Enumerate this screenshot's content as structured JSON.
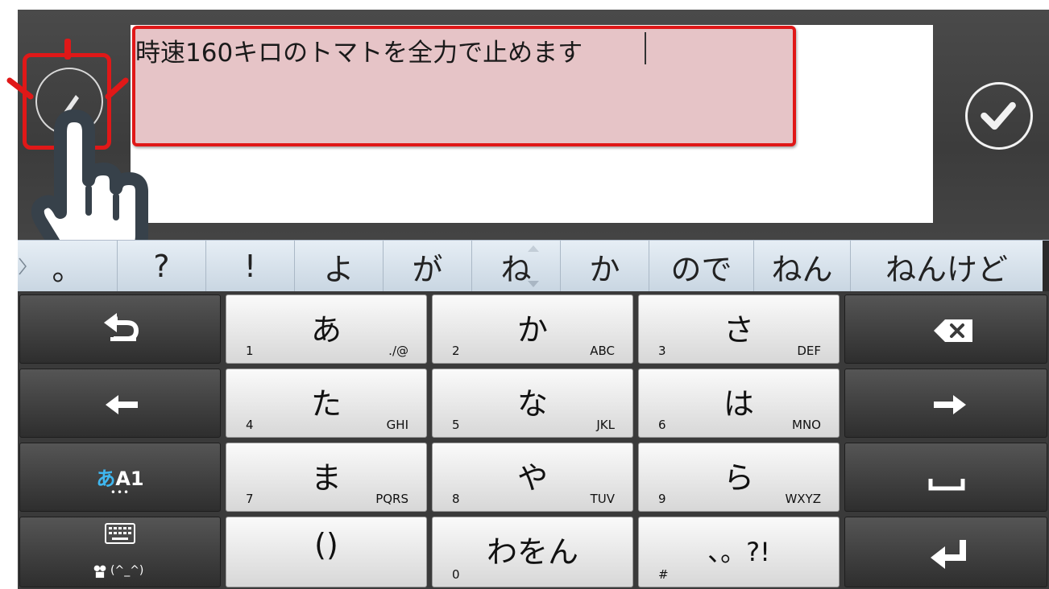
{
  "input": {
    "text": "時速160キロのトマトを全力で止めます"
  },
  "icons": {
    "pen": "pen-icon",
    "confirm": "checkmark-icon",
    "hand": "pointing-hand-icon"
  },
  "candidates": [
    "。",
    "?",
    "!",
    "よ",
    "が",
    "ね",
    "か",
    "ので",
    "ねん",
    "ねんけど"
  ],
  "keys": {
    "row1": [
      {
        "kana": "あ",
        "num": "1",
        "alpha": "./@"
      },
      {
        "kana": "か",
        "num": "2",
        "alpha": "ABC"
      },
      {
        "kana": "さ",
        "num": "3",
        "alpha": "DEF"
      }
    ],
    "row2": [
      {
        "kana": "た",
        "num": "4",
        "alpha": "GHI"
      },
      {
        "kana": "な",
        "num": "5",
        "alpha": "JKL"
      },
      {
        "kana": "は",
        "num": "6",
        "alpha": "MNO"
      }
    ],
    "row3": [
      {
        "kana": "ま",
        "num": "7",
        "alpha": "PQRS"
      },
      {
        "kana": "や",
        "num": "8",
        "alpha": "TUV"
      },
      {
        "kana": "ら",
        "num": "9",
        "alpha": "WXYZ"
      }
    ],
    "row4": [
      {
        "kana": "()",
        "num": "",
        "alpha": ""
      },
      {
        "kana": "わをん",
        "num": "0",
        "alpha": ""
      },
      {
        "kana": "、。?!",
        "num": "#",
        "alpha": ""
      }
    ],
    "mode": {
      "kana": "あ",
      "latin": "A1",
      "dots": "•••"
    },
    "emoji": {
      "label": "(^_^)"
    }
  },
  "colors": {
    "highlight_border": "#e01818",
    "highlight_fill": "#e6c4c7",
    "mode_kana": "#3fb7f0"
  }
}
